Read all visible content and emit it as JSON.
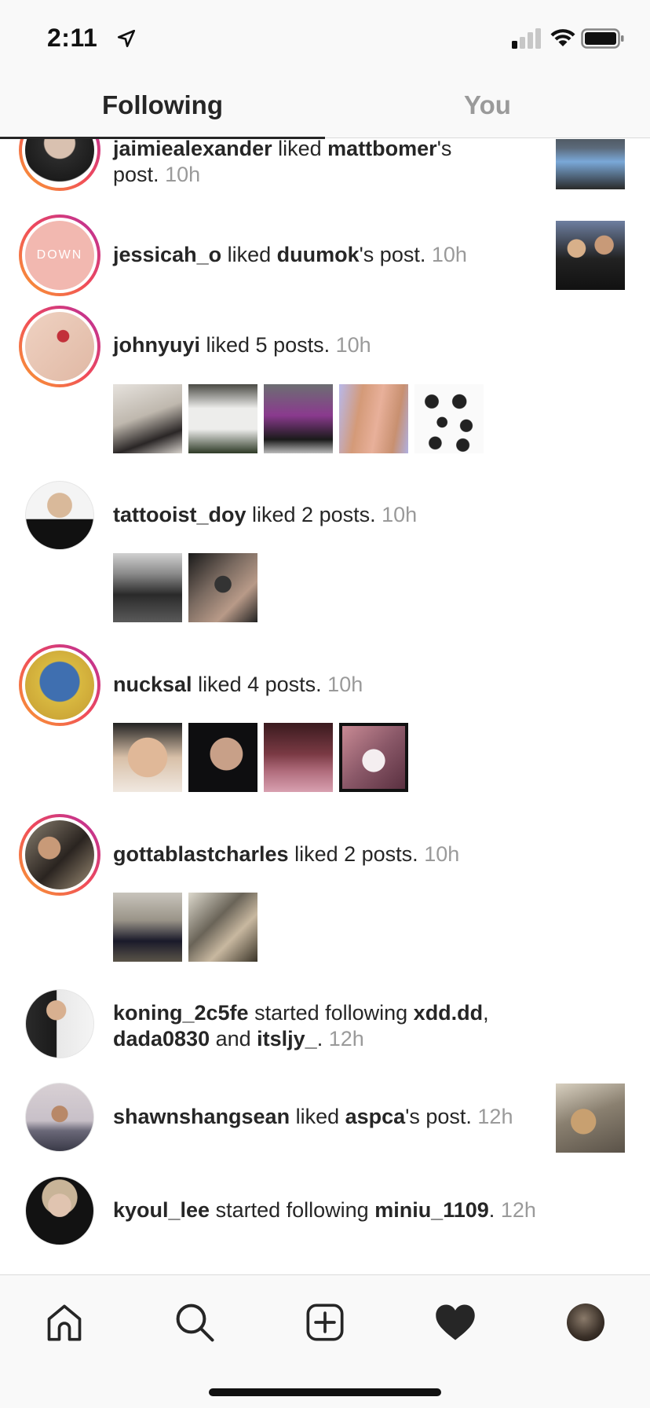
{
  "status_bar": {
    "time": "2:11"
  },
  "tabs": [
    {
      "label": "Following",
      "active": true
    },
    {
      "label": "You",
      "active": false
    }
  ],
  "feed": [
    {
      "user": "jaimiealexander",
      "action": " liked ",
      "target": "mattbomer",
      "suffix": "'s post.",
      "time": "10h",
      "story_ring": true,
      "avatar_color": "#2b2b2b"
    },
    {
      "user": "jessicah_o",
      "action": " liked ",
      "target": "duumok",
      "suffix": "'s post.",
      "time": "10h",
      "story_ring": true,
      "avatar_text": "DOWN",
      "avatar_color": "#f2b8b0"
    },
    {
      "user": "johnyuyi",
      "action": " liked 5 posts.",
      "time": "10h",
      "story_ring": true,
      "avatar_color": "#e8c8b8",
      "thumb_count": 5
    },
    {
      "user": "tattooist_doy",
      "action": " liked 2 posts.",
      "time": "10h",
      "story_ring": false,
      "avatar_color": "#1a1a1a",
      "thumb_count": 2
    },
    {
      "user": "nucksal",
      "action": " liked 4 posts.",
      "time": "10h",
      "story_ring": true,
      "avatar_color": "#3f6fb0",
      "thumb_count": 4
    },
    {
      "user": "gottablastcharles",
      "action": " liked 2 posts.",
      "time": "10h",
      "story_ring": true,
      "avatar_color": "#5a5248",
      "thumb_count": 2
    },
    {
      "user": "koning_2c5fe",
      "action": " started following ",
      "target": "xdd.dd",
      "target2": "dada0830",
      "target3": "itsljy_",
      "time": "12h",
      "story_ring": false,
      "avatar_color": "#3a3a3a"
    },
    {
      "user": "shawnshangsean",
      "action": " liked ",
      "target": "aspca",
      "suffix": "'s post.",
      "time": "12h",
      "story_ring": false,
      "avatar_color": "#c8a890"
    },
    {
      "user": "kyoul_lee",
      "action": " started following ",
      "target": "miniu_1109",
      "suffix": ".",
      "time": "12h",
      "story_ring": false,
      "avatar_color": "#1a1a1a"
    }
  ],
  "bottom_nav": [
    "home-icon",
    "search-icon",
    "new-post-icon",
    "activity-heart-icon",
    "profile-avatar"
  ]
}
